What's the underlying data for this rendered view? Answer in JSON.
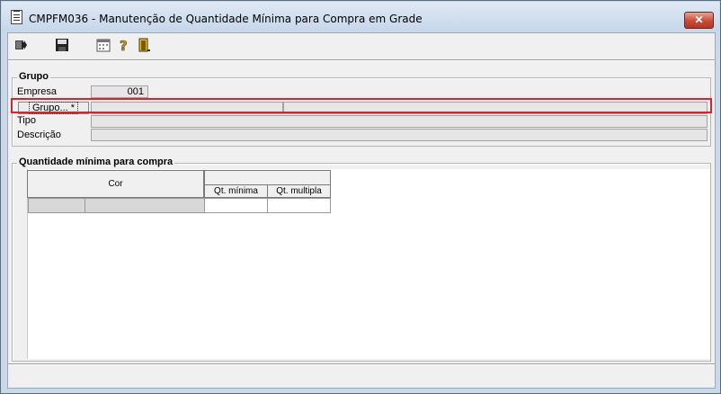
{
  "window": {
    "title": "CMPFM036 - Manutenção de Quantidade Mínima para Compra em Grade",
    "close_label": "✕"
  },
  "toolbar": {
    "buttons": [
      "exit-arrow-icon",
      "save-icon",
      "calendar-icon",
      "help-icon",
      "door-icon"
    ]
  },
  "grupo_section": {
    "title": "Grupo",
    "empresa_label": "Empresa",
    "empresa_value": "001",
    "grupo_button": "Grupo... *",
    "grupo_code": "",
    "grupo_name": "",
    "tipo_label": "Tipo",
    "tipo_value": "",
    "descricao_label": "Descrição",
    "descricao_value": ""
  },
  "qty_section": {
    "title": "Quantidade mínima para compra",
    "columns": {
      "cor": "Cor",
      "qt_minima": "Qt. mínima",
      "qt_multipla": "Qt. multipla"
    }
  },
  "colors": {
    "highlight": "#e0202a",
    "close": "#c94c35"
  }
}
